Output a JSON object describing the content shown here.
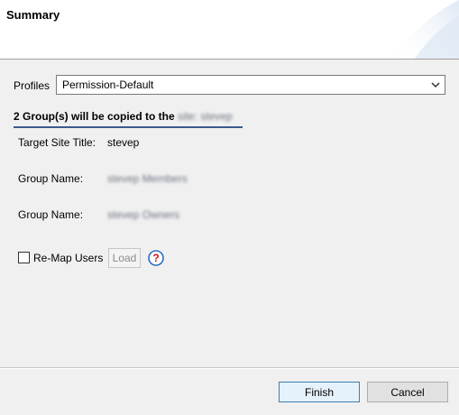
{
  "header": {
    "title": "Summary"
  },
  "profiles": {
    "label": "Profiles",
    "selected": "Permission-Default"
  },
  "section": {
    "heading_prefix": "2 Group(s) will be copied to the",
    "heading_blurred": "site: stevep"
  },
  "fields": {
    "target_site_label": "Target Site Title:",
    "target_site_value": "stevep",
    "group1_label": "Group Name:",
    "group1_value": "stevep Members",
    "group2_label": "Group Name:",
    "group2_value": "stevep Owners"
  },
  "remap": {
    "checkbox_label": "Re-Map Users",
    "checked": false,
    "load_label": "Load"
  },
  "footer": {
    "finish_label": "Finish",
    "cancel_label": "Cancel"
  },
  "colors": {
    "accent": "#3a5a8a",
    "help_red": "#d01818",
    "help_ring": "#2a6fc9"
  },
  "icons": {
    "dropdown": "chevron-down-icon",
    "help": "help-icon"
  }
}
